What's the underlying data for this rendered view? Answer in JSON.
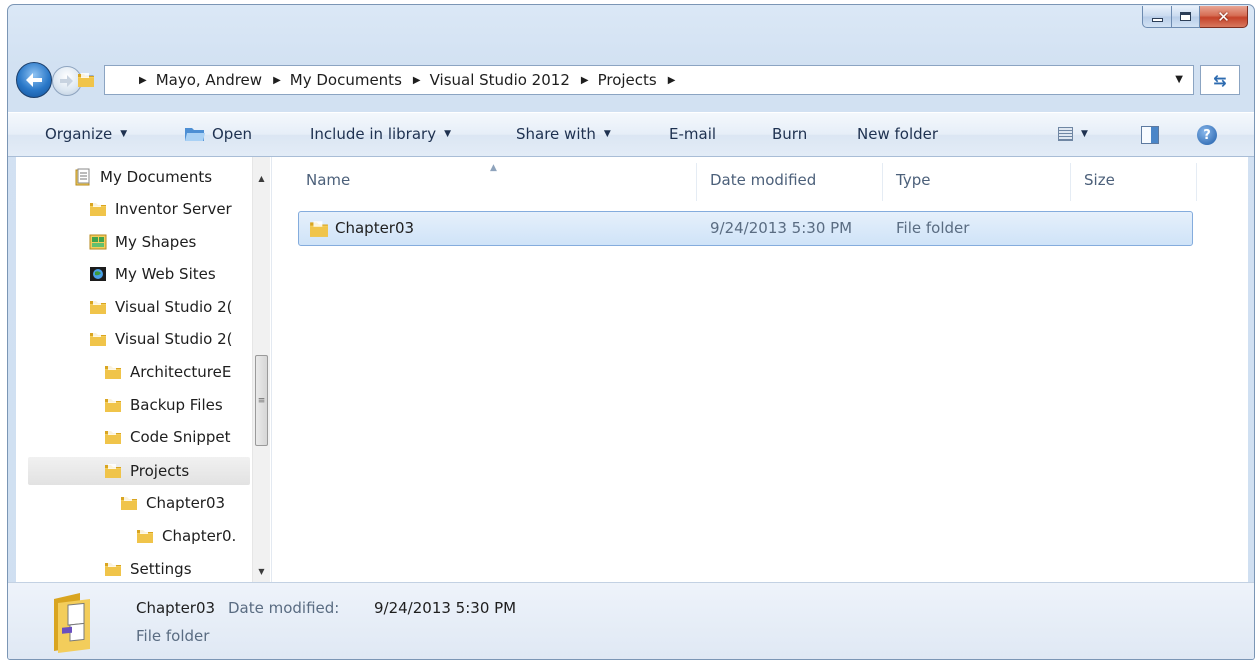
{
  "window": {
    "caption_buttons": {
      "minimize": "minimize",
      "maximize": "maximize",
      "close": "✕"
    }
  },
  "address_bar": {
    "breadcrumbs": [
      "Mayo, Andrew",
      "My Documents",
      "Visual Studio 2012",
      "Projects"
    ]
  },
  "toolbar": {
    "organize": "Organize",
    "open": "Open",
    "include_in_library": "Include in library",
    "share_with": "Share with",
    "email": "E-mail",
    "burn": "Burn",
    "new_folder": "New folder"
  },
  "nav_tree": {
    "items": [
      {
        "label": "My Documents",
        "icon": "documents-icon"
      },
      {
        "label": "Inventor Server",
        "icon": "folder-icon"
      },
      {
        "label": "My Shapes",
        "icon": "shapes-icon"
      },
      {
        "label": "My Web Sites",
        "icon": "web-sites-icon"
      },
      {
        "label": "Visual Studio 2(",
        "icon": "folder-icon"
      },
      {
        "label": "Visual Studio 2(",
        "icon": "folder-icon"
      },
      {
        "label": "ArchitectureE",
        "icon": "folder-icon"
      },
      {
        "label": "Backup Files",
        "icon": "folder-icon"
      },
      {
        "label": "Code Snippet",
        "icon": "folder-icon"
      },
      {
        "label": "Projects",
        "icon": "folder-icon",
        "selected": true
      },
      {
        "label": "Chapter03",
        "icon": "folder-icon"
      },
      {
        "label": "Chapter0.",
        "icon": "folder-icon"
      },
      {
        "label": "Settings",
        "icon": "folder-icon"
      }
    ]
  },
  "file_list": {
    "columns": {
      "name": "Name",
      "date_modified": "Date modified",
      "type": "Type",
      "size": "Size"
    },
    "rows": [
      {
        "name": "Chapter03",
        "date_modified": "9/24/2013 5:30 PM",
        "type": "File folder",
        "size": ""
      }
    ]
  },
  "details_pane": {
    "name": "Chapter03",
    "date_label": "Date modified:",
    "date_value": "9/24/2013 5:30 PM",
    "type": "File folder"
  },
  "colors": {
    "accent": "#2a78c8",
    "selection": "#cfe3f8",
    "folder": "#e8b93a"
  }
}
